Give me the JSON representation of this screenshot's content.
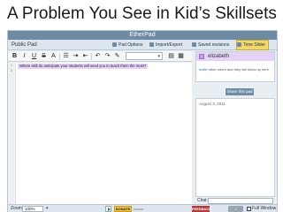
{
  "slide": {
    "title": "A Problem You See in Kid’s Skillsets"
  },
  "app": {
    "brand": "EtherPad",
    "pad_label": "Public Pad",
    "nav": {
      "pad_options": "Pad Options",
      "import_export": "Import/Export",
      "saved_revisions": "Saved revisions",
      "time_slider": "Time Slider"
    }
  },
  "toolbar": {
    "bold": "B",
    "italic": "I",
    "underline": "U",
    "strike": "S",
    "style_caret": "▾"
  },
  "editor": {
    "line_numbers": [
      "1",
      "2"
    ],
    "line1": "Where skill do anticipate your students will need you to teach them the most?"
  },
  "sidebar": {
    "user_name": "elizabeth",
    "invite_link": "Invite",
    "invite_rest": " other users and they will show up here.",
    "share_button": "Share this pad",
    "chat_date": "August 3, 2011",
    "chat_label": "Chat:"
  },
  "bottom": {
    "zoom_label": "Zoom:",
    "zoom_value": "100%",
    "zoom_caret": "▾",
    "donate": "DONATE",
    "feedback": "FEEDBACK",
    "full_window": "Full Window"
  }
}
